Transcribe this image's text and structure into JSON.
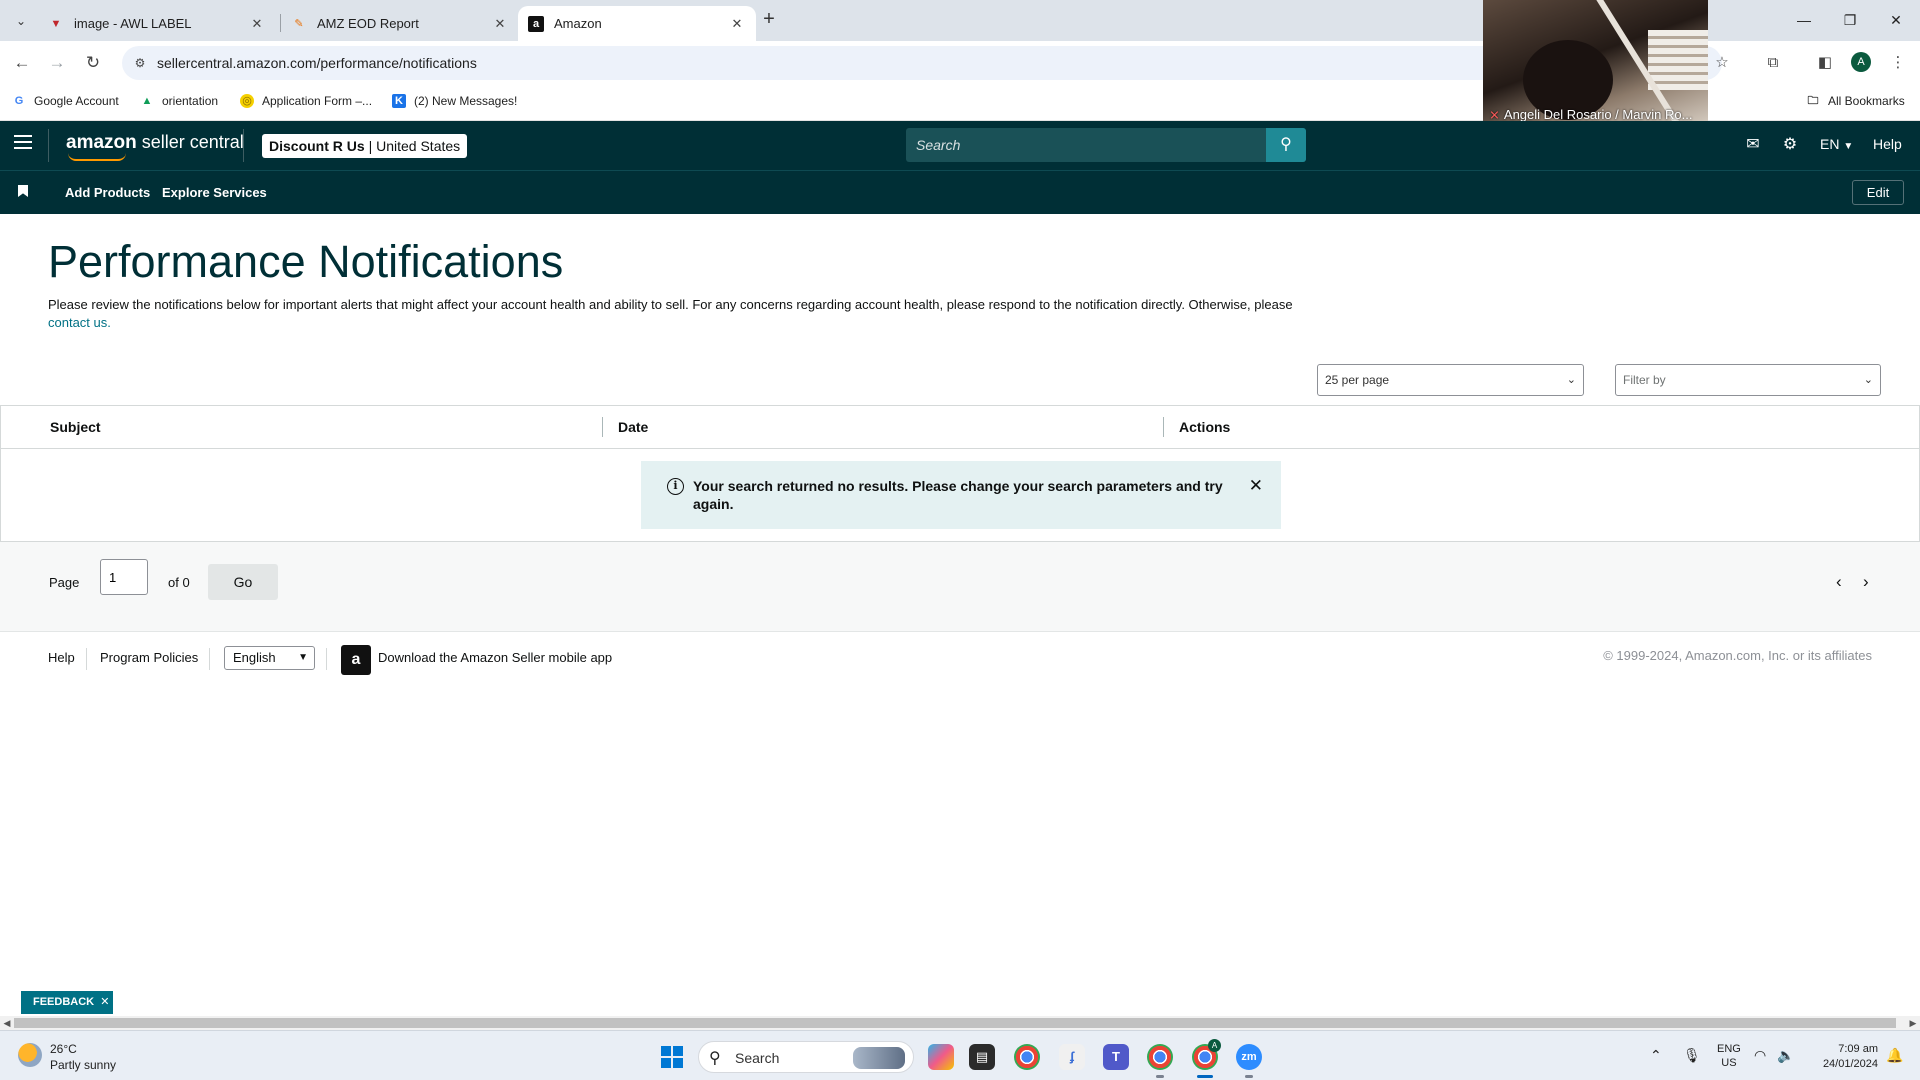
{
  "browser": {
    "tabs": [
      {
        "title": "image - AWL LABEL",
        "favicon": "awl-logo-icon",
        "active": false
      },
      {
        "title": "AMZ EOD Report",
        "favicon": "sheets-icon",
        "active": false
      },
      {
        "title": "Amazon",
        "favicon": "amazon-a-icon",
        "active": true
      }
    ],
    "url": "sellercentral.amazon.com/performance/notifications",
    "bookmarks": [
      {
        "label": "Google Account",
        "icon": "google-icon"
      },
      {
        "label": "orientation",
        "icon": "drive-icon"
      },
      {
        "label": "Application Form –...",
        "icon": "form-icon"
      },
      {
        "label": "(2) New Messages!",
        "icon": "k-icon"
      }
    ],
    "all_bookmarks_label": "All Bookmarks",
    "profile_initial": "A"
  },
  "video_call": {
    "label": "Angeli Del Rosario / Marvin Ro..."
  },
  "header": {
    "logo_primary": "amazon",
    "logo_secondary": "seller central",
    "account_name": "Discount R Us",
    "account_sep": "|",
    "account_region": "United States",
    "search_placeholder": "Search",
    "language": "EN",
    "help": "Help"
  },
  "nav": {
    "links": [
      "Add Products",
      "Explore Services"
    ],
    "edit": "Edit"
  },
  "main": {
    "title": "Performance Notifications",
    "intro": "Please review the notifications below for important alerts that might affect your account health and ability to sell. For any concerns regarding account health, please respond to the notification directly. Otherwise, please ",
    "intro_link": "contact us.",
    "per_page": "25 per page",
    "filter_placeholder": "Filter by",
    "columns": [
      "Subject",
      "Date",
      "Actions"
    ],
    "alert": "Your search returned no results. Please change your search parameters and try again.",
    "pager": {
      "page_label": "Page",
      "page_value": "1",
      "of_label": "of 0",
      "go": "Go"
    }
  },
  "footer": {
    "help": "Help",
    "policies": "Program Policies",
    "language": "English",
    "app_link": "Download the Amazon Seller mobile app",
    "copyright": "© 1999-2024, Amazon.com, Inc. or its affiliates"
  },
  "feedback": "FEEDBACK",
  "taskbar": {
    "temperature": "26°C",
    "weather": "Partly sunny",
    "search": "Search",
    "lang_line1": "ENG",
    "lang_line2": "US",
    "time": "7:09 am",
    "date": "24/01/2024",
    "chrome_badge": "A"
  },
  "colors": {
    "brand_header": "#002f36",
    "link": "#007185",
    "alert_bg": "#e4f1f2"
  }
}
